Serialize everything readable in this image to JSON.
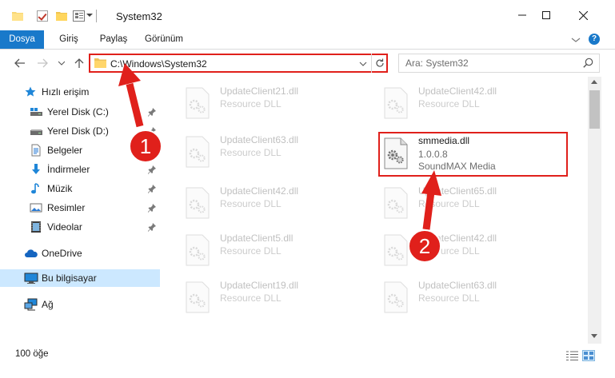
{
  "window": {
    "title": "System32",
    "minimize_icon": "minimize-icon",
    "maximize_icon": "maximize-icon",
    "close_icon": "close-icon"
  },
  "ribbon": {
    "tabs": [
      {
        "label": "Dosya",
        "active": true
      },
      {
        "label": "Giriş"
      },
      {
        "label": "Paylaş"
      },
      {
        "label": "Görünüm"
      }
    ],
    "help_label": "?"
  },
  "address": {
    "path": "C:\\Windows\\System32",
    "search_placeholder": "Ara: System32"
  },
  "nav_pane": {
    "items": [
      {
        "label": "Hızlı erişim",
        "icon": "star-icon"
      },
      {
        "label": "Yerel Disk (C:)",
        "icon": "drive-icon",
        "pinned": true
      },
      {
        "label": "Yerel Disk (D:)",
        "icon": "drive-icon",
        "pinned": true
      },
      {
        "label": "Belgeler",
        "icon": "documents-icon",
        "pinned": true
      },
      {
        "label": "İndirmeler",
        "icon": "download-icon",
        "pinned": true
      },
      {
        "label": "Müzik",
        "icon": "music-icon",
        "pinned": true
      },
      {
        "label": "Resimler",
        "icon": "pictures-icon",
        "pinned": true
      },
      {
        "label": "Videolar",
        "icon": "video-icon",
        "pinned": true
      },
      {
        "label": "OneDrive",
        "icon": "cloud-icon"
      },
      {
        "label": "Bu bilgisayar",
        "icon": "computer-icon",
        "selected": true
      },
      {
        "label": "Ağ",
        "icon": "network-icon"
      }
    ]
  },
  "files": {
    "left": [
      {
        "name": "UpdateClient21.dll",
        "desc": "Resource DLL"
      },
      {
        "name": "UpdateClient63.dll",
        "desc": "Resource DLL"
      },
      {
        "name": "UpdateClient42.dll",
        "desc": "Resource DLL"
      },
      {
        "name": "UpdateClient5.dll",
        "desc": "Resource DLL"
      },
      {
        "name": "UpdateClient19.dll",
        "desc": "Resource DLL"
      }
    ],
    "right": [
      {
        "name": "UpdateClient42.dll",
        "desc": "Resource DLL"
      },
      {
        "name": "smmedia.dll",
        "desc": "1.0.0.8",
        "sub": "SoundMAX Media",
        "focused": true
      },
      {
        "name": "UpdateClient65.dll",
        "desc": "Resource DLL"
      },
      {
        "name": "UpdateClient42.dll",
        "desc": "Resource DLL"
      },
      {
        "name": "UpdateClient63.dll",
        "desc": "Resource DLL"
      }
    ]
  },
  "status": {
    "count": "100 öğe"
  },
  "annotations": {
    "step1": "1",
    "step2": "2",
    "color": "#e0201b"
  },
  "colors": {
    "accent": "#1979ca",
    "selection": "#cce8ff",
    "highlight": "#e0201b"
  }
}
